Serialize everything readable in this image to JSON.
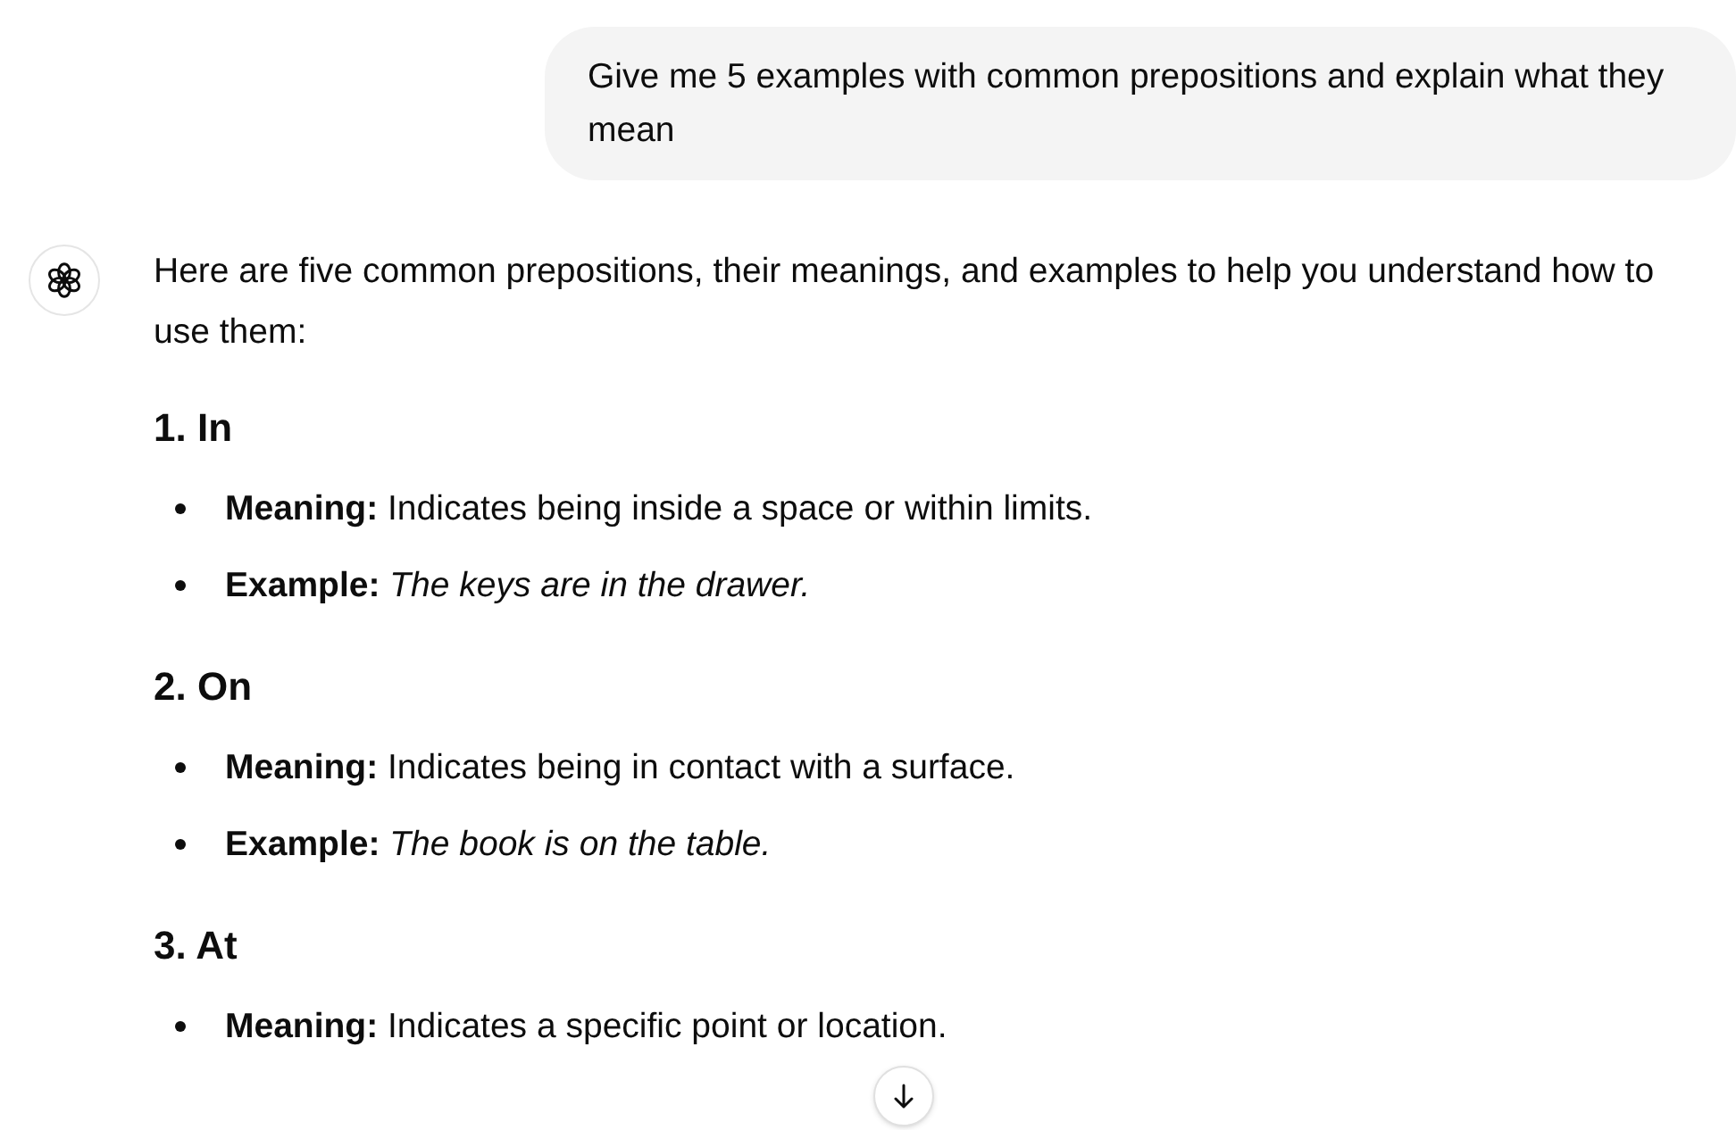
{
  "user_message": "Give me 5 examples with common prepositions and explain what they mean",
  "assistant": {
    "intro": "Here are five common prepositions, their meanings, and examples to help you understand how to use them:",
    "sections": [
      {
        "heading": "1. In",
        "items": [
          {
            "kind": "meaning",
            "label": "Meaning:",
            "text": "Indicates being inside a space or within limits."
          },
          {
            "kind": "example",
            "label": "Example:",
            "text": "The keys are in the drawer."
          }
        ]
      },
      {
        "heading": "2. On",
        "items": [
          {
            "kind": "meaning",
            "label": "Meaning:",
            "text": "Indicates being in contact with a surface."
          },
          {
            "kind": "example",
            "label": "Example:",
            "text": "The book is on the table."
          }
        ]
      },
      {
        "heading": "3. At",
        "items": [
          {
            "kind": "meaning",
            "label": "Meaning:",
            "text": "Indicates a specific point or location."
          }
        ]
      }
    ]
  }
}
